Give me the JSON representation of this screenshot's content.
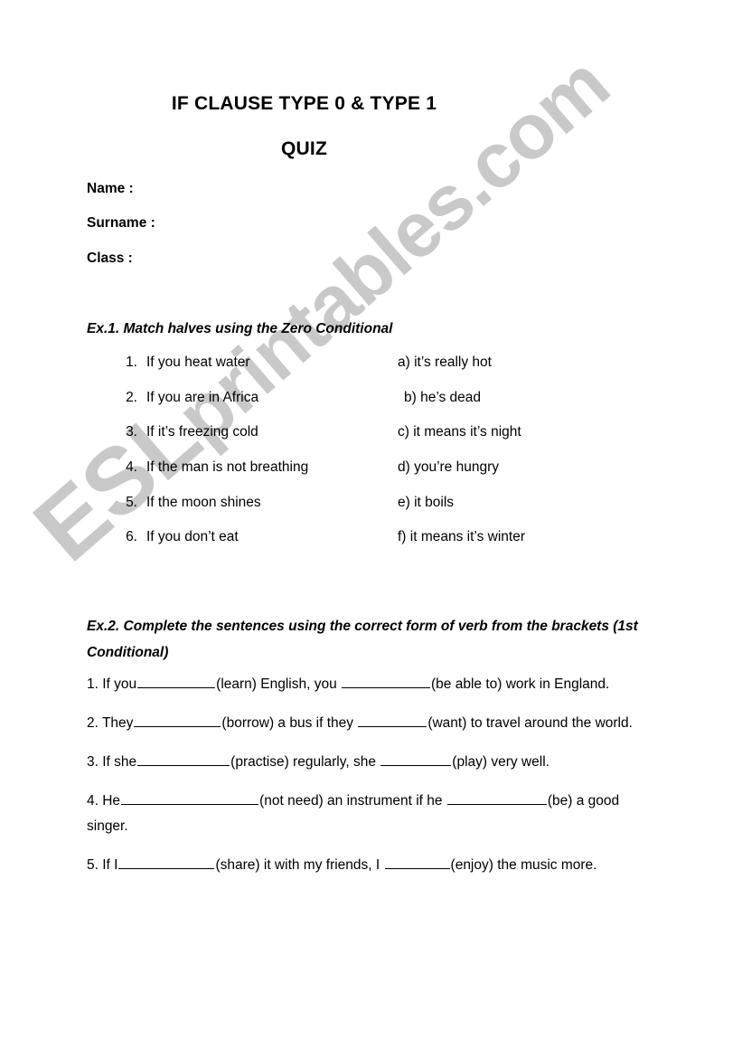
{
  "document": {
    "title_main": "IF CLAUSE TYPE 0 & TYPE 1",
    "title_sub": "QUIZ",
    "watermark": "ESLprintables.com",
    "watermark_color": "#c9c9c9"
  },
  "fields": {
    "name": "Name :",
    "surname": "Surname :",
    "class": "Class :"
  },
  "exercise1": {
    "heading": "Ex.1. Match halves using the Zero Conditional",
    "items": [
      {
        "num": "1.",
        "left": "If you heat water",
        "right": "a) it’s really hot"
      },
      {
        "num": "2.",
        "left": "If you are in Africa",
        "right": "b) he’s dead"
      },
      {
        "num": "3.",
        "left": "If it’s freezing cold",
        "right": "c) it means it’s night"
      },
      {
        "num": "4.",
        "left": "If the man is not breathing",
        "right": "d) you’re hungry"
      },
      {
        "num": "5.",
        "left": "If the moon shines",
        "right": "e) it boils"
      },
      {
        "num": "6.",
        "left": "If you don’t eat",
        "right": "f) it means it’s winter"
      }
    ]
  },
  "exercise2": {
    "heading": "Ex.2. Complete the sentences using the correct form of verb from the brackets (1st Conditional)",
    "items": [
      {
        "num": "1.",
        "seg1": "1. If you",
        "blank1_width": 86,
        "seg2": "(learn) English, you",
        "blank2_width": 98,
        "seg3": "(be able to) work in England."
      },
      {
        "num": "2.",
        "seg1": "2. They",
        "blank1_width": 96,
        "seg2": "(borrow) a bus if they",
        "blank2_width": 76,
        "seg3": "(want) to travel around the world."
      },
      {
        "num": "3.",
        "seg1": "3. If she",
        "blank1_width": 102,
        "seg2": "(practise) regularly, she",
        "blank2_width": 78,
        "seg3": "(play) very well."
      },
      {
        "num": "4.",
        "seg1": "4. He",
        "blank1_width": 152,
        "seg2": "(not need) an instrument if he",
        "blank2_width": 110,
        "seg3": "(be) a good singer."
      },
      {
        "num": "5.",
        "seg1": "5. If I",
        "blank1_width": 106,
        "seg2": "(share) it with my friends, I",
        "blank2_width": 72,
        "seg3": "(enjoy) the music more."
      }
    ]
  }
}
